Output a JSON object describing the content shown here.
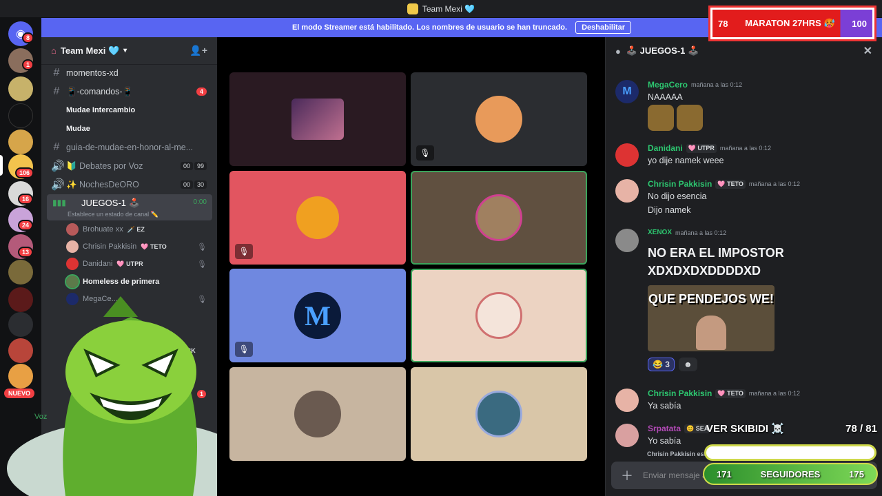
{
  "window": {
    "title": "Team Mexi 🩵"
  },
  "streamer_banner": {
    "text": "El modo Streamer está habilitado. Los nombres de usuario se han truncado.",
    "button": "Deshabilitar"
  },
  "rail": {
    "badges": [
      "8",
      "1",
      "106",
      "16",
      "24",
      "13"
    ],
    "nuevo_label": "NUEVO"
  },
  "guild": {
    "name": "Team Mexi 🩵"
  },
  "channels": [
    {
      "name": "momentos-xd"
    },
    {
      "name": "📱-comandos-📱",
      "badge": "4"
    },
    {
      "name": "Mudae Intercambio"
    },
    {
      "name": "Mudae"
    },
    {
      "name": "guia-de-mudae-en-honor-al-me..."
    },
    {
      "name": "🔰 Debates por Voz",
      "counts": [
        "00",
        "99"
      ]
    },
    {
      "name": "✨ NochesDeORO",
      "counts": [
        "00",
        "30"
      ]
    },
    {
      "name": "JUEGOS-1 🕹️",
      "timer": "0:00",
      "status": "Establece un estado de canal ✏️"
    }
  ],
  "members": [
    {
      "name": "Brohuate xx",
      "tag": "🗡️ EZ"
    },
    {
      "name": "Chrisin Pakkisin",
      "tag": "🩷 TETO"
    },
    {
      "name": "Danidani",
      "tag": "🩷 UTPR"
    },
    {
      "name": "Homeless de primera",
      "tag": ""
    },
    {
      "name": "MegaCe...",
      "tag": ""
    }
  ],
  "hidden_row": {
    "tag": "💚 KICK",
    "badge": "1",
    "voice": "Voz"
  },
  "chat": {
    "title": "🕹️ JUEGOS-1 🕹️",
    "messages": [
      {
        "author": "MegaCero",
        "tag": "",
        "time": "mañana a las 0:12",
        "lines": [
          "NAAAAA"
        ],
        "color": "#2dc770"
      },
      {
        "author": "Danidani",
        "tag": "🩷 UTPR",
        "time": "mañana a las 0:12",
        "lines": [
          "yo dije namek weee"
        ],
        "color": "#2dc770"
      },
      {
        "author": "Chrisin Pakkisin",
        "tag": "🩷 TETO",
        "time": "mañana a las 0:12",
        "lines": [
          "No dijo esencia",
          "Dijo namek"
        ],
        "color": "#2dc770"
      },
      {
        "author": "XENOX",
        "tag": "",
        "time": "mañana a las 0:12",
        "lines": [
          "NO ERA EL IMPOSTOR",
          "XDXDXDXDDDDXD"
        ],
        "color": "#2dc770"
      },
      {
        "author": "Chrisin Pakkisin",
        "tag": "🩷 TETO",
        "time": "mañana a las 0:12",
        "lines": [
          "Ya sabía"
        ],
        "color": "#2dc770"
      },
      {
        "author": "Srpatata",
        "tag": "😊 SEA",
        "time": "",
        "lines": [
          "Yo sabía"
        ],
        "color": "#b34ab7"
      }
    ],
    "gif_caption": "QUE PENDEJOS WE!",
    "reaction_count": "3",
    "typing": "Chrisin Pakkisin está escribiendo...",
    "composer_placeholder": "Enviar mensaje a 🕹️ JUEGOS-1 🕹️"
  },
  "overlay": {
    "top_left_num": "78",
    "top_text": "MARATON 27HRS 🥵",
    "top_right_num": "100",
    "skibidi_text": "VER SKIBIDI ☠️",
    "skibidi_count": "78  / 81",
    "followers_label": "SEGUIDORES",
    "followers_current": "171",
    "followers_goal": "175"
  },
  "colors": {
    "blurple": "#5865f2",
    "speaking": "#3ba55c",
    "danger": "#f23f43"
  }
}
